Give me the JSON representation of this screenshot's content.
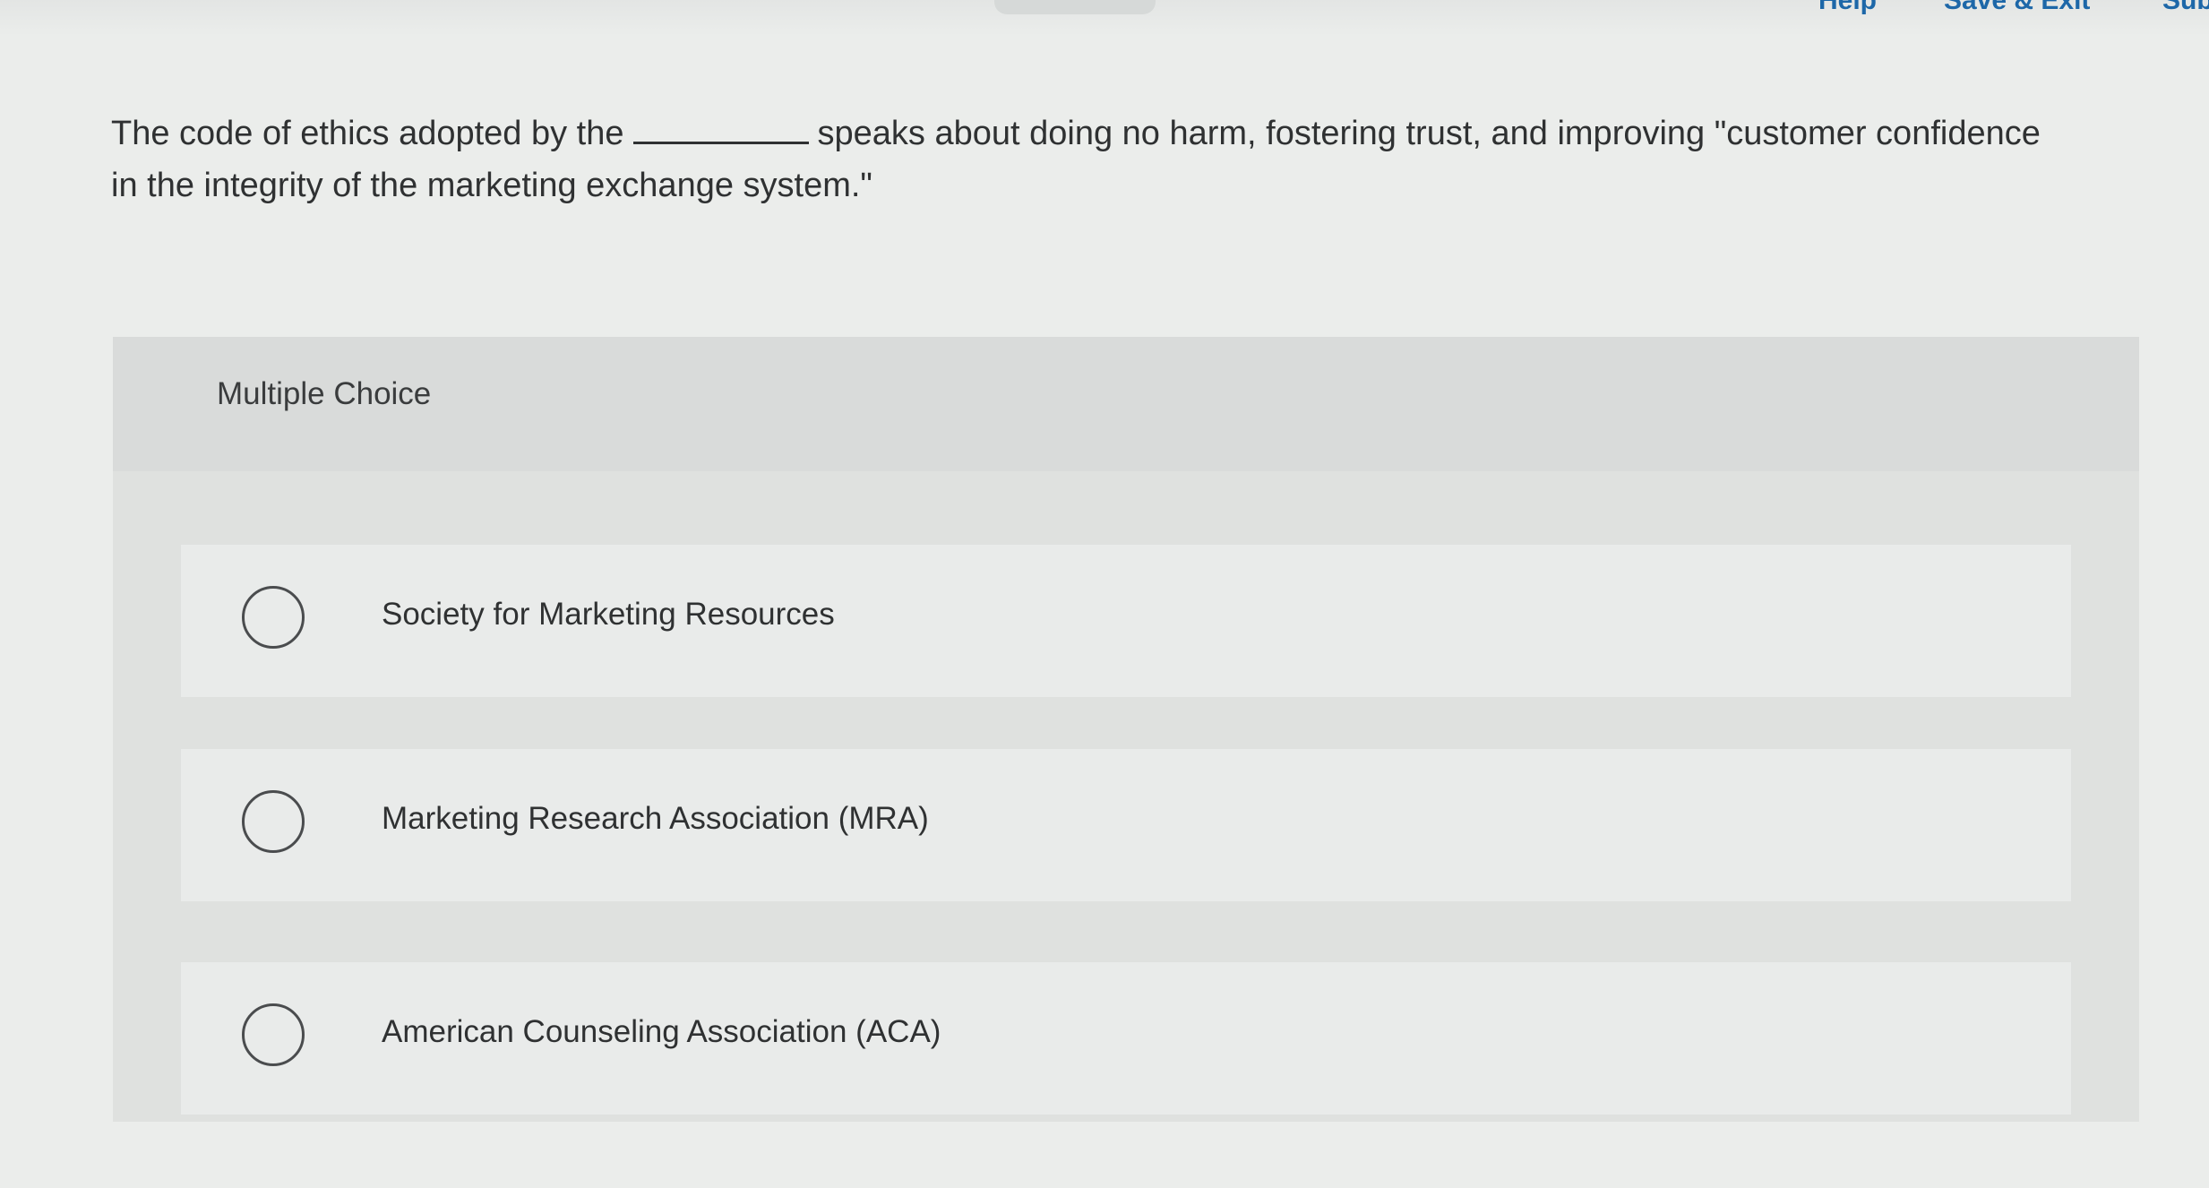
{
  "header": {
    "help_label": "Help",
    "save_exit_label": "Save & Exit",
    "submit_label": "Sub"
  },
  "question": {
    "text_before_blank": "The code of ethics adopted by the",
    "text_after_blank": "speaks about doing no harm, fostering trust, and improving \"customer confidence in the integrity of the marketing exchange system.\""
  },
  "multiple_choice": {
    "label": "Multiple Choice",
    "options": [
      {
        "label": "Society for Marketing Resources",
        "selected": false
      },
      {
        "label": "Marketing Research Association (MRA)",
        "selected": false
      },
      {
        "label": "American Counseling Association (ACA)",
        "selected": false
      }
    ]
  }
}
